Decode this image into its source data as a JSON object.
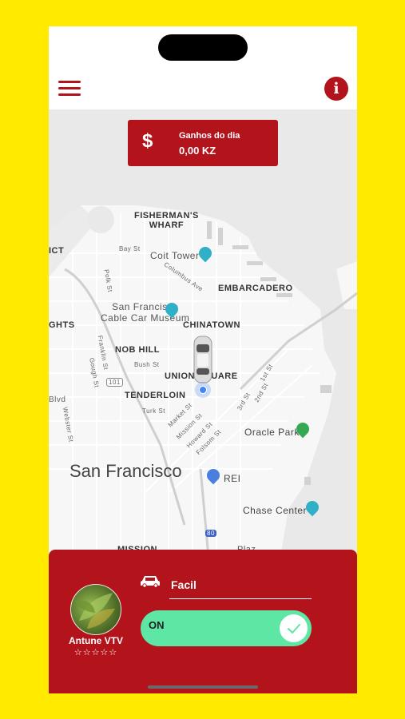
{
  "header": {
    "menu_icon": "hamburger-menu-icon",
    "info_icon": "info-icon",
    "info_glyph": "i"
  },
  "earnings": {
    "currency_symbol": "$",
    "label": "Ganhos do dia",
    "amount": "0,00 KZ"
  },
  "map": {
    "labels": {
      "fishermans_wharf": "FISHERMAN'S\nWHARF",
      "coit_tower": "Coit Tower",
      "embarcadero": "EMBARCADERO",
      "cable_car_museum": "San Francisco\nCable Car Museum",
      "chinatown": "CHINATOWN",
      "nob_hill": "NOB HILL",
      "union_square": "UNION SQUARE",
      "tenderloin": "TENDERLOIN",
      "oracle_park": "Oracle Park",
      "san_francisco": "San Francisco",
      "rei": "REI",
      "chase_center": "Chase Center",
      "mission": "MISSION",
      "heights": "GHTS",
      "ict": "ICT",
      "plaza": "Plaz",
      "highway_101": "101",
      "highway_80": "80",
      "bay_st": "Bay St",
      "columbus_ave": "Columbus Ave",
      "polk_st": "Polk St",
      "franklin_st": "Franklin St",
      "gough_st": "Gough St",
      "bush_st": "Bush St",
      "turk_st": "Turk St",
      "market_st": "Market St",
      "mission_st": "Mission St",
      "howard_st": "Howard St",
      "folsom_st": "Folsom St",
      "third_st": "3rd St",
      "second_st": "2nd St",
      "first_st": "1st St",
      "webster_st": "Webster St",
      "blvd": "Blvd"
    }
  },
  "driver": {
    "name": "Antune VTV",
    "rating_stars": "☆☆☆☆☆",
    "vehicle_icon": "car-icon",
    "category_value": "Facil",
    "status_label": "ON",
    "status_check": "✓"
  },
  "colors": {
    "brand_red": "#b3141b",
    "background_yellow": "#FFEA00",
    "toggle_green": "#5ee6a5"
  }
}
